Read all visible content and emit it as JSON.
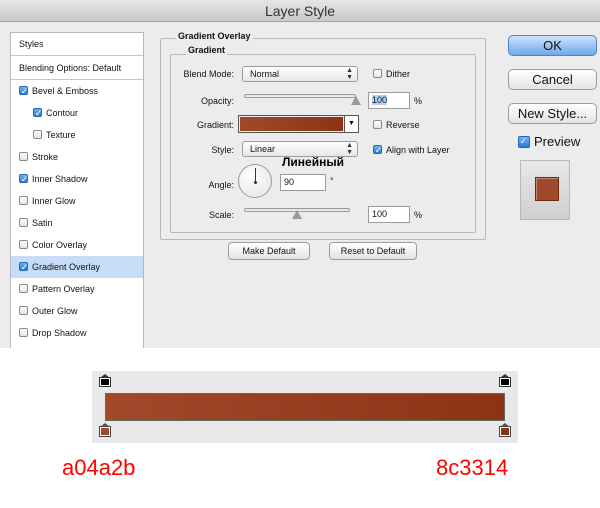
{
  "window": {
    "title": "Layer Style"
  },
  "sidebar": {
    "styles_header": "Styles",
    "blending_header": "Blending Options: Default",
    "items": [
      {
        "label": "Bevel & Emboss",
        "checked": true,
        "indent": false,
        "selected": false
      },
      {
        "label": "Contour",
        "checked": true,
        "indent": true,
        "selected": false
      },
      {
        "label": "Texture",
        "checked": false,
        "indent": true,
        "selected": false
      },
      {
        "label": "Stroke",
        "checked": false,
        "indent": false,
        "selected": false
      },
      {
        "label": "Inner Shadow",
        "checked": true,
        "indent": false,
        "selected": false
      },
      {
        "label": "Inner Glow",
        "checked": false,
        "indent": false,
        "selected": false
      },
      {
        "label": "Satin",
        "checked": false,
        "indent": false,
        "selected": false
      },
      {
        "label": "Color Overlay",
        "checked": false,
        "indent": false,
        "selected": false
      },
      {
        "label": "Gradient Overlay",
        "checked": true,
        "indent": false,
        "selected": true
      },
      {
        "label": "Pattern Overlay",
        "checked": false,
        "indent": false,
        "selected": false
      },
      {
        "label": "Outer Glow",
        "checked": false,
        "indent": false,
        "selected": false
      },
      {
        "label": "Drop Shadow",
        "checked": false,
        "indent": false,
        "selected": false
      }
    ]
  },
  "panel": {
    "section_title": "Gradient Overlay",
    "group_title": "Gradient",
    "blend_mode_label": "Blend Mode:",
    "blend_mode_value": "Normal",
    "dither_label": "Dither",
    "dither_checked": false,
    "opacity_label": "Opacity:",
    "opacity_value": "100",
    "opacity_fraction": 1.0,
    "percent": "%",
    "gradient_label": "Gradient:",
    "reverse_label": "Reverse",
    "reverse_checked": false,
    "style_label": "Style:",
    "style_value": "Linear",
    "align_label": "Align with Layer",
    "align_checked": true,
    "angle_label": "Angle:",
    "angle_value": "90",
    "degree": "°",
    "angle_degrees": 90,
    "scale_label": "Scale:",
    "scale_value": "100",
    "scale_fraction": 0.5,
    "make_default": "Make Default",
    "reset_default": "Reset to Default",
    "annotation": "Линейный"
  },
  "buttons": {
    "ok": "OK",
    "cancel": "Cancel",
    "new_style": "New Style...",
    "preview_label": "Preview",
    "preview_checked": true
  },
  "colors": {
    "start": "#a04a2b",
    "end": "#8c3314"
  },
  "gradient_editor": {
    "start_hex": "a04a2b",
    "end_hex": "8c3314"
  }
}
